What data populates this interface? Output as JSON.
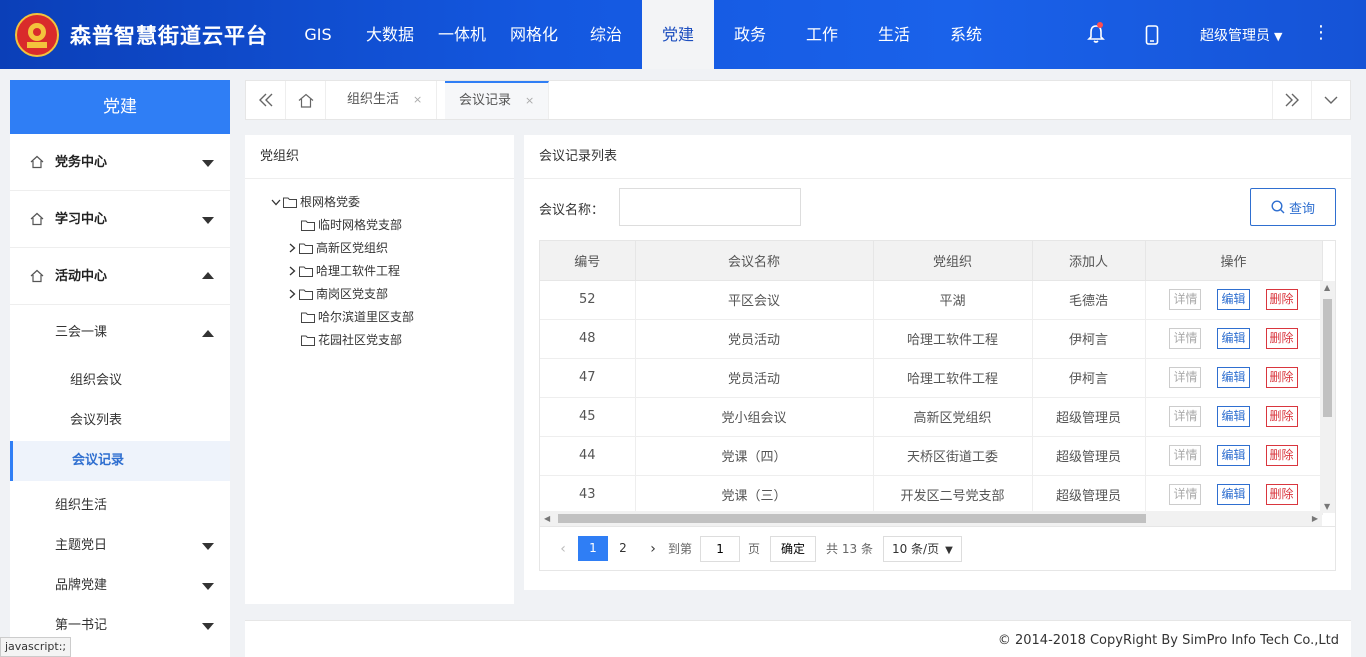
{
  "header": {
    "site_title": "森普智慧街道云平台",
    "nav": [
      "GIS",
      "大数据",
      "一体机",
      "网格化",
      "综治",
      "党建",
      "政务",
      "工作",
      "生活",
      "系统"
    ],
    "active_nav": "党建",
    "user_name": "超级管理员",
    "accent_color": "#1458e0"
  },
  "sidebar": {
    "title": "党建",
    "groups": [
      "党务中心",
      "学习中心",
      "活动中心"
    ],
    "subgroup": "三会一课",
    "leaves": [
      "组织会议",
      "会议列表",
      "会议记录"
    ],
    "active_leaf": "会议记录",
    "more": [
      "组织生活",
      "主题党日",
      "品牌党建",
      "第一书记"
    ]
  },
  "tabs": [
    {
      "label": "组织生活",
      "close": "×"
    },
    {
      "label": "会议记录",
      "close": "×"
    }
  ],
  "org_panel": {
    "title": "党组织",
    "tree": [
      {
        "label": "根网格党委",
        "level": 0,
        "expanded": true
      },
      {
        "label": "临时网格党支部",
        "level": 1
      },
      {
        "label": "高新区党组织",
        "level": 1,
        "collapsed": true
      },
      {
        "label": "哈理工软件工程",
        "level": 1,
        "collapsed": true
      },
      {
        "label": "南岗区党支部",
        "level": 1,
        "collapsed": true
      },
      {
        "label": "哈尔滨道里区支部",
        "level": 1
      },
      {
        "label": "花园社区党支部",
        "level": 1
      }
    ]
  },
  "main": {
    "title": "会议记录列表",
    "search_label": "会议名称：",
    "search_value": "",
    "query_label": "查询",
    "columns": [
      "编号",
      "会议名称",
      "党组织",
      "添加人",
      "操作"
    ],
    "ops": {
      "detail": "详情",
      "edit": "编辑",
      "delete": "删除"
    },
    "rows": [
      {
        "id": "52",
        "name": "平区会议",
        "org": "平湖",
        "adder": "毛德浩"
      },
      {
        "id": "48",
        "name": "党员活动",
        "org": "哈理工软件工程",
        "adder": "伊柯言"
      },
      {
        "id": "47",
        "name": "党员活动",
        "org": "哈理工软件工程",
        "adder": "伊柯言"
      },
      {
        "id": "45",
        "name": "党小组会议",
        "org": "高新区党组织",
        "adder": "超级管理员"
      },
      {
        "id": "44",
        "name": "党课（四）",
        "org": "天桥区街道工委",
        "adder": "超级管理员"
      },
      {
        "id": "43",
        "name": "党课（三）",
        "org": "开发区二号党支部",
        "adder": "超级管理员"
      }
    ],
    "pager": {
      "pages": [
        "1",
        "2"
      ],
      "current": "1",
      "goto_label": "到第",
      "goto_value": "1",
      "page_unit": "页",
      "confirm": "确定",
      "total": "共 13 条",
      "page_size": "10 条/页"
    }
  },
  "footer": {
    "copyright": "© 2014-2018 CopyRight By SimPro Info Tech Co.,Ltd"
  },
  "status_tip": "javascript:;"
}
